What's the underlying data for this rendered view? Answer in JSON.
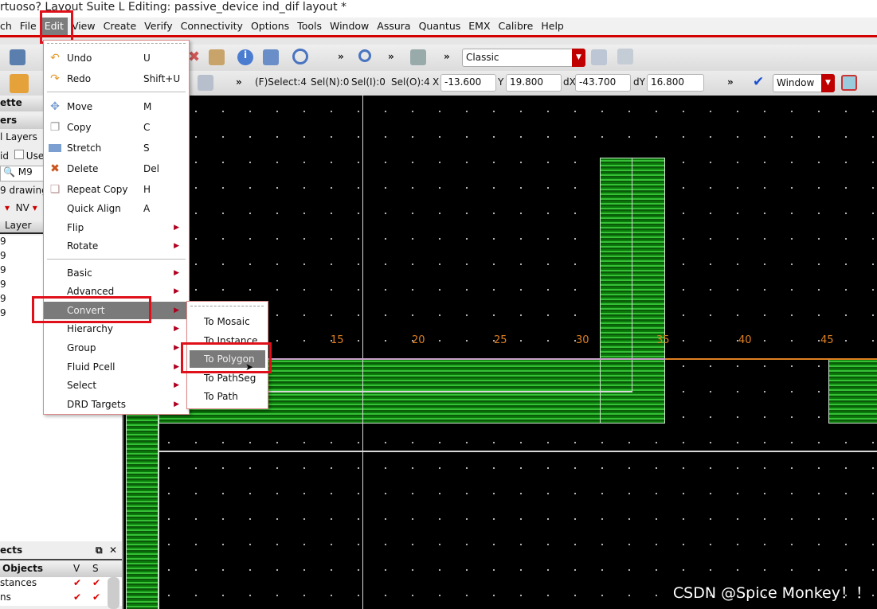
{
  "window": {
    "title": "rtuoso? Layout Suite L Editing: passive_device ind_dif layout *"
  },
  "menubar": [
    "ch",
    "File",
    "Edit",
    "View",
    "Create",
    "Verify",
    "Connectivity",
    "Options",
    "Tools",
    "Window",
    "Assura",
    "Quantus",
    "EMX",
    "Calibre",
    "Help"
  ],
  "toolbar": {
    "workspace": "Classic",
    "overflow": "»",
    "view_mode": "Window"
  },
  "status": {
    "fselect": "(F)Select:4",
    "seln": "Sel(N):0",
    "seli": "Sel(I):0",
    "selo": "Sel(O):4",
    "x_label": "X",
    "x": "-13.600",
    "y_label": "Y",
    "y": "19.800",
    "dx_label": "dX",
    "dx": "-43.700",
    "dy_label": "dY",
    "dy": "16.800"
  },
  "left_panel": {
    "palette": "ette",
    "layers": "ers",
    "all_layers": "l Layers",
    "valid": "id",
    "used": "Use",
    "search": "M9",
    "layer_select": "9 drawing",
    "nv": "NV",
    "col_layer": "Layer",
    "rows": [
      "9",
      "9",
      "9",
      "9",
      "9",
      "9"
    ],
    "objects_title": "ects",
    "objects_header": "Objects",
    "col_v": "V",
    "col_s": "S",
    "object_rows": [
      {
        "name": "stances",
        "v": true,
        "s": true
      },
      {
        "name": "ns",
        "v": true,
        "s": true
      }
    ]
  },
  "edit_menu": {
    "items": [
      {
        "label": "Undo",
        "shortcut": "U",
        "icon": "undo-icon"
      },
      {
        "label": "Redo",
        "shortcut": "Shift+U",
        "icon": "redo-icon"
      },
      {
        "label": "Move",
        "shortcut": "M",
        "icon": "move-icon"
      },
      {
        "label": "Copy",
        "shortcut": "C",
        "icon": "copy-icon"
      },
      {
        "label": "Stretch",
        "shortcut": "S",
        "icon": "stretch-icon"
      },
      {
        "label": "Delete",
        "shortcut": "Del",
        "icon": "delete-icon"
      },
      {
        "label": "Repeat Copy",
        "shortcut": "H",
        "icon": "repeat-copy-icon"
      },
      {
        "label": "Quick Align",
        "shortcut": "A"
      },
      {
        "label": "Flip",
        "submenu": true
      },
      {
        "label": "Rotate",
        "submenu": true
      },
      {
        "label": "Basic",
        "submenu": true
      },
      {
        "label": "Advanced",
        "submenu": true
      },
      {
        "label": "Convert",
        "submenu": true,
        "highlighted": true
      },
      {
        "label": "Hierarchy",
        "submenu": true
      },
      {
        "label": "Group",
        "submenu": true
      },
      {
        "label": "Fluid Pcell",
        "submenu": true
      },
      {
        "label": "Select",
        "submenu": true
      },
      {
        "label": "DRD Targets",
        "submenu": true
      }
    ]
  },
  "convert_submenu": {
    "items": [
      "To Mosaic",
      "To Instance",
      "To Polygon",
      "To PathSeg",
      "To Path"
    ],
    "highlighted": "To Polygon"
  },
  "ruler": {
    "labels": [
      "15",
      "20",
      "25",
      "30",
      "35",
      "40",
      "45"
    ],
    "color": "#e08020"
  },
  "colors": {
    "highlight_box": "#e0101a",
    "layer_fill": "#36c036"
  },
  "watermark": "CSDN @Spice Monkey！！"
}
